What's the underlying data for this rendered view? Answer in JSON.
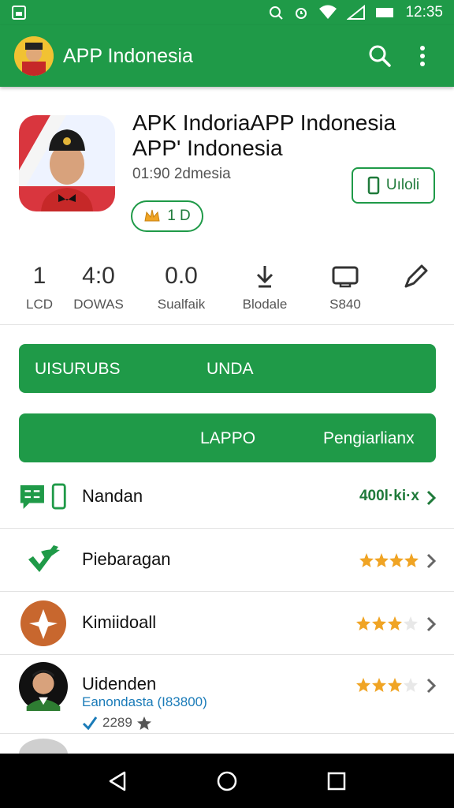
{
  "status_bar": {
    "time": "12:35"
  },
  "app_bar": {
    "title": "APP Indonesia"
  },
  "app": {
    "title_line1": "APK IndoriaAPP Indonesia",
    "title_line2": "APP' Indonesia",
    "subtitle": "01:90 2dmesia",
    "rating_badge": "1 D",
    "install_label": "Uıloli"
  },
  "stats": [
    {
      "value": "1",
      "label": "LCD"
    },
    {
      "value": "4:0",
      "label": "DOWAS"
    },
    {
      "value": "0.0",
      "label": "Sualfaik"
    },
    {
      "value": "",
      "label": "Blodale"
    },
    {
      "value": "",
      "label": "S840"
    },
    {
      "value": "",
      "label": ""
    }
  ],
  "buttons": {
    "primary_left": "UISURUBS",
    "primary_center": "UNDA",
    "secondary_center": "LAPPO",
    "secondary_right": "Pengiarlianx"
  },
  "list": [
    {
      "label": "Nandan",
      "meta": "400l·ki·x",
      "icon": "chat-phone-icon"
    },
    {
      "label": "Piebaragan",
      "stars": 4,
      "icon": "check-icon"
    },
    {
      "label": "Kimiidoall",
      "stars": 3,
      "icon": "compass-icon"
    },
    {
      "label": "Uidenden",
      "sub": "Eanondasta (I83800)",
      "sub2": "2289",
      "stars": 3,
      "icon": "user-avatar"
    }
  ],
  "colors": {
    "primary": "#1f9a48",
    "star": "#f0a424"
  }
}
